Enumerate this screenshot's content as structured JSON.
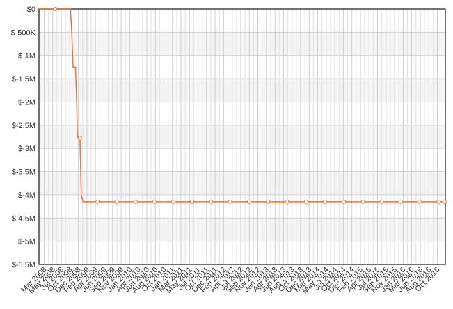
{
  "chart_data": {
    "type": "line",
    "title": "",
    "xlabel": "",
    "ylabel": "",
    "ylim": [
      -5500000,
      0
    ],
    "grid": true,
    "legend": "none",
    "y_ticks": [
      {
        "value": 0,
        "label": "$0"
      },
      {
        "value": -500000,
        "label": "$-500K"
      },
      {
        "value": -1000000,
        "label": "$-1M"
      },
      {
        "value": -1500000,
        "label": "$-1.5M"
      },
      {
        "value": -2000000,
        "label": "$-2M"
      },
      {
        "value": -2500000,
        "label": "$-2.5M"
      },
      {
        "value": -3000000,
        "label": "$-3M"
      },
      {
        "value": -3500000,
        "label": "$-3.5M"
      },
      {
        "value": -4000000,
        "label": "$-4M"
      },
      {
        "value": -4500000,
        "label": "$-4.5M"
      },
      {
        "value": -5000000,
        "label": "$-5M"
      },
      {
        "value": -5500000,
        "label": "$-5.5M"
      }
    ],
    "x_ticks": [
      "Mar 2008",
      "May 2008",
      "Jul 2008",
      "Oct 2008",
      "Dec 2008",
      "Feb 2009",
      "Apr 2009",
      "Jun 2009",
      "Sep 2009",
      "Nov 2009",
      "Jan 2010",
      "Apr 2010",
      "Jun 2010",
      "Aug 2010",
      "Oct 2010",
      "Jan 2011",
      "Mar 2011",
      "May 2011",
      "Jul 2011",
      "Oct 2011",
      "Dec 2011",
      "Feb 2012",
      "Apr 2012",
      "Jul 2012",
      "Sep 2012",
      "Nov 2012",
      "Jan 2013",
      "Apr 2013",
      "Jun 2013",
      "Aug 2013",
      "Oct 2013",
      "Dec 2013",
      "Mar 2014",
      "May 2014",
      "Jul 2014",
      "Oct 2014",
      "Dec 2014",
      "Feb 2015",
      "Apr 2015",
      "Jul 2015",
      "Sep 2015",
      "Nov 2015",
      "Jan 2016",
      "Mar 2016",
      "Jun 2016",
      "Aug 2016",
      "Oct 2016"
    ],
    "series": [
      {
        "color": "#e8743b",
        "points": [
          {
            "x": "2008-01-01",
            "y": 0
          },
          {
            "x": "2008-05-10",
            "y": 0,
            "marker": true
          },
          {
            "x": "2008-09-10",
            "y": 0
          },
          {
            "x": "2008-09-20",
            "y": -500000
          },
          {
            "x": "2008-10-01",
            "y": -1250000
          },
          {
            "x": "2008-10-20",
            "y": -1250000
          },
          {
            "x": "2008-10-28",
            "y": -1850000
          },
          {
            "x": "2008-11-05",
            "y": -2780000
          },
          {
            "x": "2008-11-25",
            "y": -2780000,
            "marker": true
          },
          {
            "x": "2008-12-05",
            "y": -4000000
          },
          {
            "x": "2008-12-20",
            "y": -4150000
          },
          {
            "x": "2009-04-15",
            "y": -4150000,
            "marker": true
          },
          {
            "x": "2009-09-15",
            "y": -4150000,
            "marker": true
          },
          {
            "x": "2010-02-15",
            "y": -4150000,
            "marker": true
          },
          {
            "x": "2010-07-15",
            "y": -4150000,
            "marker": true
          },
          {
            "x": "2010-12-15",
            "y": -4150000,
            "marker": true
          },
          {
            "x": "2011-05-15",
            "y": -4150000,
            "marker": true
          },
          {
            "x": "2011-10-15",
            "y": -4150000,
            "marker": true
          },
          {
            "x": "2012-03-15",
            "y": -4150000,
            "marker": true
          },
          {
            "x": "2012-08-15",
            "y": -4150000,
            "marker": true
          },
          {
            "x": "2013-01-15",
            "y": -4150000,
            "marker": true
          },
          {
            "x": "2013-06-15",
            "y": -4150000,
            "marker": true
          },
          {
            "x": "2013-11-15",
            "y": -4150000,
            "marker": true
          },
          {
            "x": "2014-04-15",
            "y": -4150000,
            "marker": true
          },
          {
            "x": "2014-09-15",
            "y": -4150000,
            "marker": true
          },
          {
            "x": "2015-02-15",
            "y": -4150000,
            "marker": true
          },
          {
            "x": "2015-07-15",
            "y": -4150000,
            "marker": true
          },
          {
            "x": "2015-12-15",
            "y": -4150000,
            "marker": true
          },
          {
            "x": "2016-05-15",
            "y": -4150000,
            "marker": true
          },
          {
            "x": "2016-10-15",
            "y": -4150000,
            "marker": true
          },
          {
            "x": "2016-12-01",
            "y": -4150000,
            "marker": true
          }
        ]
      }
    ]
  }
}
